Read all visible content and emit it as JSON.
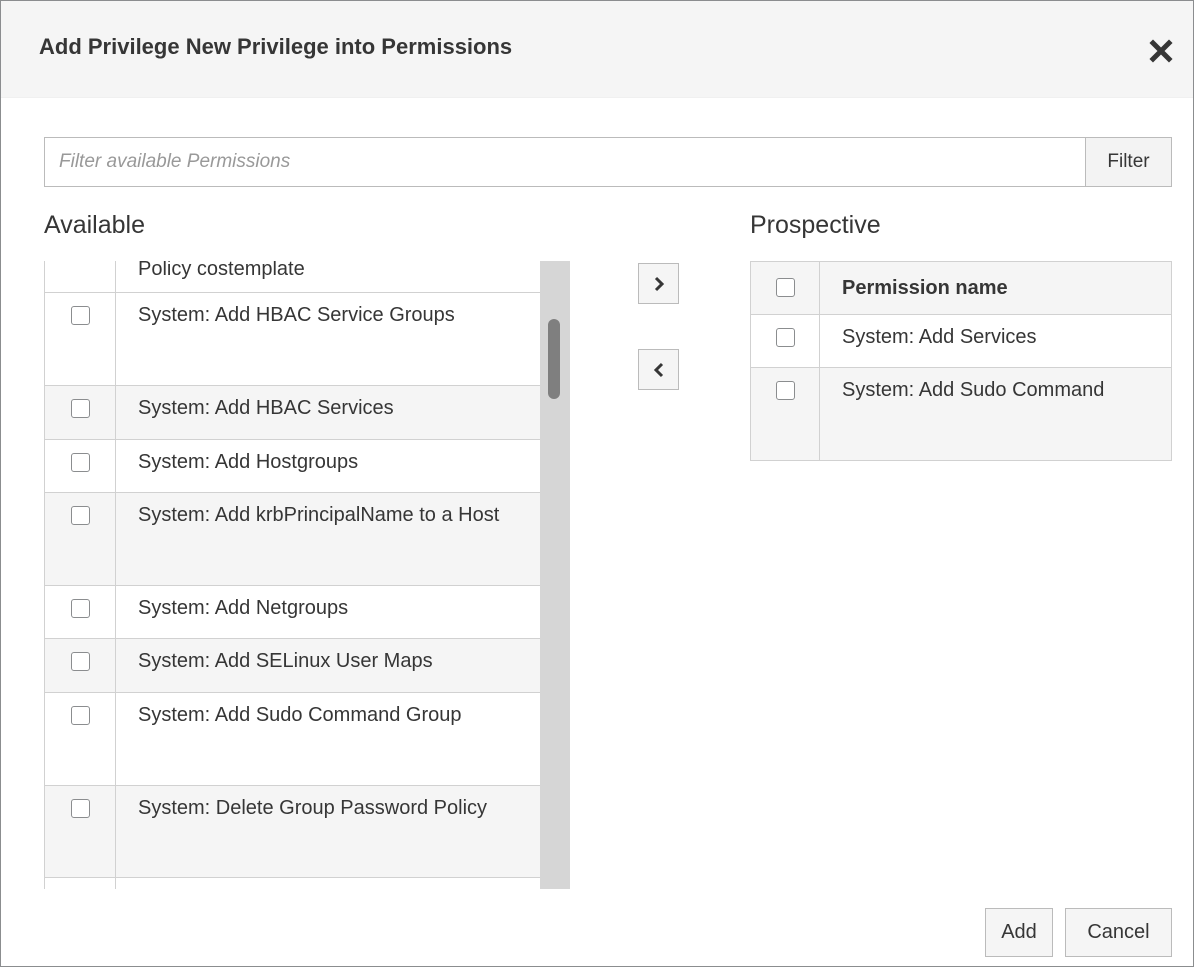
{
  "dialog": {
    "title": "Add Privilege New Privilege into Permissions",
    "close_icon": "close-icon"
  },
  "filter": {
    "placeholder": "Filter available Permissions",
    "value": "",
    "button_label": "Filter"
  },
  "available": {
    "label": "Available",
    "items": [
      "Policy costemplate",
      "System: Add HBAC Service Groups",
      "System: Add HBAC Services",
      "System: Add Hostgroups",
      "System: Add krbPrincipalName to a Host",
      "System: Add Netgroups",
      "System: Add SELinux User Maps",
      "System: Add Sudo Command Group",
      "System: Delete Group Password Policy",
      ""
    ]
  },
  "transfer": {
    "add_icon": "chevron-right-icon",
    "remove_icon": "chevron-left-icon"
  },
  "prospective": {
    "label": "Prospective",
    "header": "Permission name",
    "items": [
      "System: Add Services",
      "System: Add Sudo Command"
    ]
  },
  "buttons": {
    "add": "Add",
    "cancel": "Cancel"
  }
}
